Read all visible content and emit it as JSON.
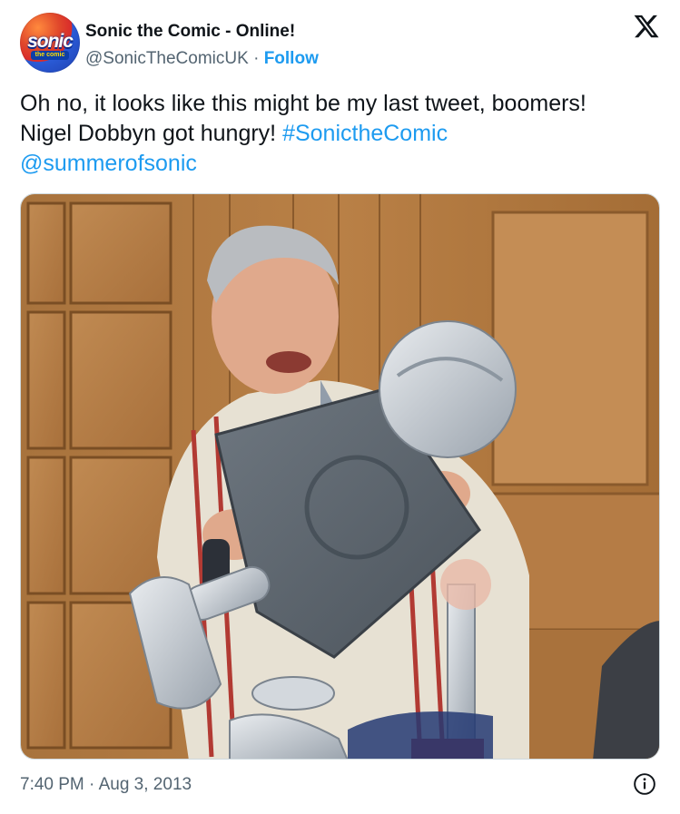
{
  "account": {
    "display_name": "Sonic the Comic - Online!",
    "handle": "@SonicTheComicUK",
    "separator": " · ",
    "follow_label": "Follow",
    "avatar_logo": "sonic",
    "avatar_sub": "the comic"
  },
  "brand_icon": "x-logo-icon",
  "tweet": {
    "text_line1": "Oh no, it looks like this might be my last tweet, boomers!",
    "text_line2": "Nigel Dobbyn got hungry! ",
    "hashtag": "#SonictheComic",
    "mention": "@summerofsonic"
  },
  "media": {
    "description_icon": "photo"
  },
  "footer": {
    "timestamp": "7:40 PM · Aug 3, 2013",
    "info_icon": "info-icon"
  },
  "colors": {
    "link": "#1d9bf0",
    "text": "#0f1419",
    "secondary": "#536471"
  }
}
